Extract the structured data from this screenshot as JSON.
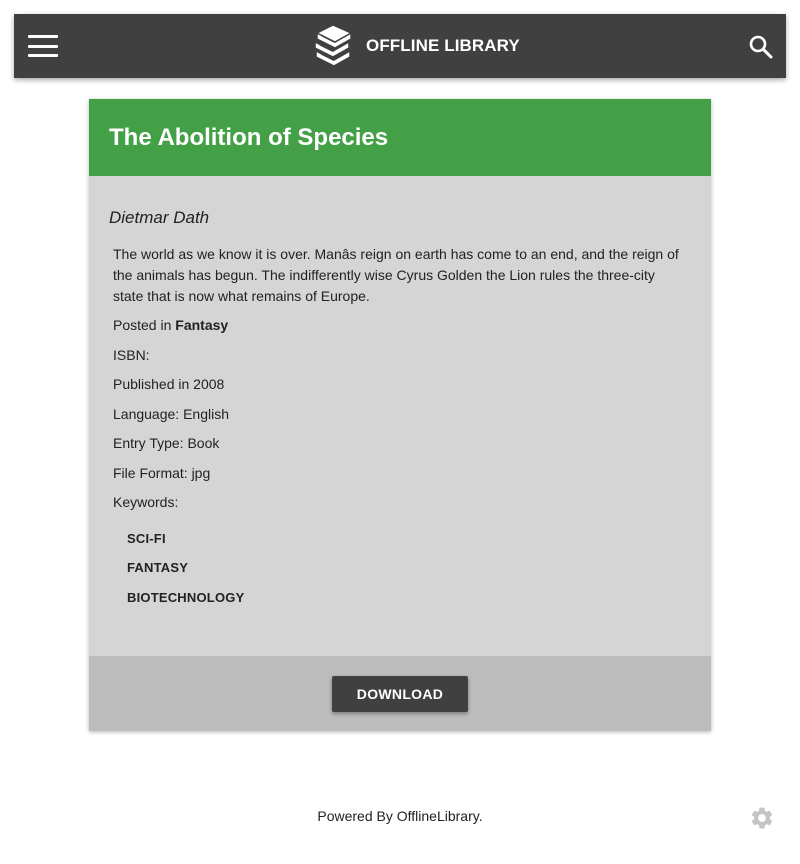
{
  "header": {
    "app_title": "OFFLINE LIBRARY",
    "menu_icon": "hamburger-menu-icon",
    "logo_icon": "books-stack-icon",
    "search_icon": "search-icon",
    "background_color": "#404040"
  },
  "book": {
    "title": "The Abolition of Species",
    "header_color": "#43a047",
    "author": "Dietmar Dath",
    "description": "The world as we know it is over. Manâs reign on earth has come to an end, and the reign of the animals has begun. The indifferently wise Cyrus Golden the Lion rules the three-city state that is now what remains of Europe.",
    "posted_in_label": "Posted in",
    "category": "Fantasy",
    "isbn_label": "ISBN:",
    "isbn_value": "",
    "published": "Published in 2008",
    "language": "Language: English",
    "entry_type": "Entry Type: Book",
    "file_format": "File Format: jpg",
    "keywords_label": "Keywords:",
    "keywords": [
      "SCI-FI",
      "FANTASY",
      "BIOTECHNOLOGY"
    ],
    "download_label": "DOWNLOAD"
  },
  "footer": {
    "text": "Powered By OfflineLibrary.",
    "settings_icon": "gear-icon"
  }
}
